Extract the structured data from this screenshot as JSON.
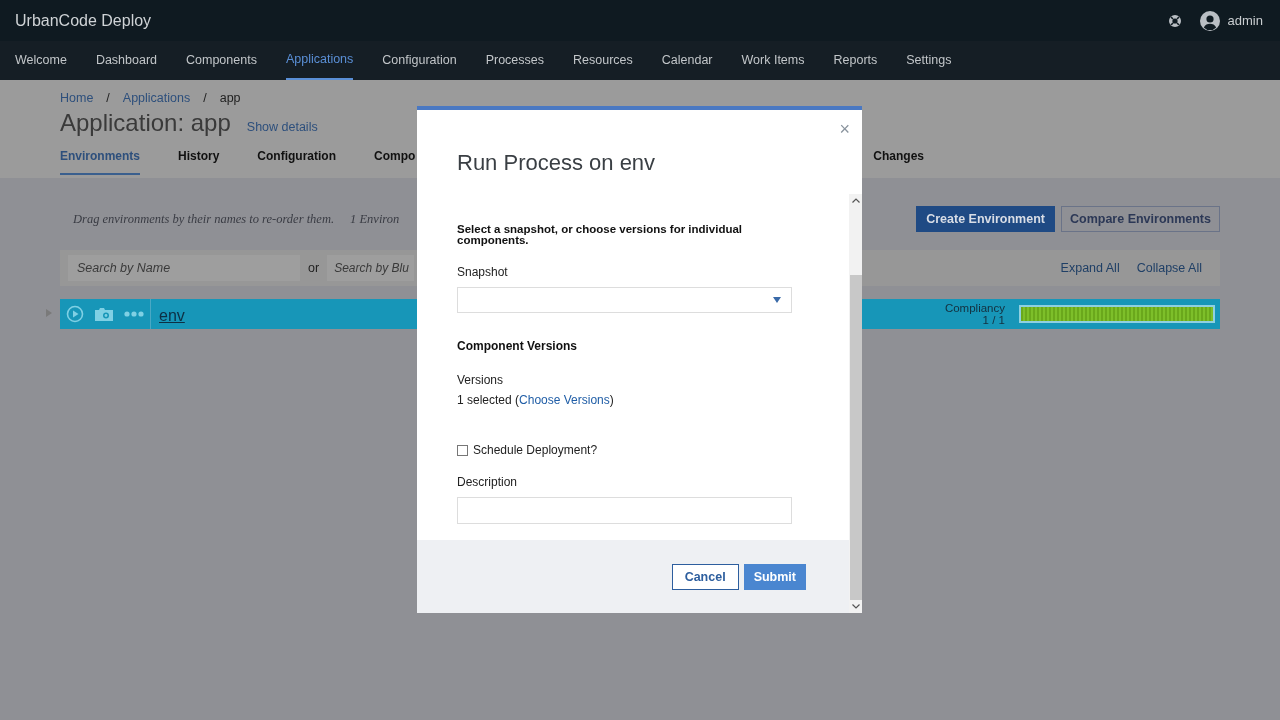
{
  "app_header": {
    "title": "UrbanCode Deploy",
    "user": "admin"
  },
  "nav": [
    {
      "label": "Welcome",
      "selected": false
    },
    {
      "label": "Dashboard",
      "selected": false
    },
    {
      "label": "Components",
      "selected": false
    },
    {
      "label": "Applications",
      "selected": true
    },
    {
      "label": "Configuration",
      "selected": false
    },
    {
      "label": "Processes",
      "selected": false
    },
    {
      "label": "Resources",
      "selected": false
    },
    {
      "label": "Calendar",
      "selected": false
    },
    {
      "label": "Work Items",
      "selected": false
    },
    {
      "label": "Reports",
      "selected": false
    },
    {
      "label": "Settings",
      "selected": false
    }
  ],
  "breadcrumb": [
    {
      "label": "Home",
      "kind": "link"
    },
    {
      "label": "/",
      "kind": "separator"
    },
    {
      "label": "Applications",
      "kind": "link"
    },
    {
      "label": "/",
      "kind": "separator"
    },
    {
      "label": "app",
      "kind": "current"
    }
  ],
  "page": {
    "title": "Application: app",
    "show_details": "Show details"
  },
  "tabs": [
    {
      "label": "Environments",
      "selected": true
    },
    {
      "label": "History",
      "selected": false
    },
    {
      "label": "Configuration",
      "selected": false
    },
    {
      "label": "Compo",
      "selected": false
    },
    {
      "label": "Changes",
      "selected": false
    }
  ],
  "environments": {
    "hint": "Drag environments by their names to re-order them.",
    "count": "1 Environ",
    "create_button": "Create Environment",
    "compare_button": {
      "label": "Compare Environments",
      "disabled": true
    },
    "search_name": {
      "placeholder": "Search by Name"
    },
    "or": "or",
    "search_blueprint": {
      "placeholder": "Search by Blu"
    },
    "expand_all": "Expand All",
    "collapse_all": "Collapse All",
    "rows": [
      {
        "name": "env",
        "expanded": false,
        "compliancy_label": "Compliancy",
        "compliancy_value": "1 / 1",
        "level": 1
      }
    ]
  },
  "modal": {
    "title": "Run Process on env",
    "close": "×",
    "instruction": "Select a snapshot, or choose versions for individual components.",
    "snapshot_label": "Snapshot",
    "section_title": "Component Versions",
    "versions_label": "Versions",
    "versions_prefix": "1 selected (",
    "versions_link": "Choose Versions",
    "versions_suffix": ")",
    "schedule": {
      "label": "Schedule Deployment?",
      "checked": false
    },
    "description_label": "Description",
    "cancel": "Cancel",
    "submit": "Submit"
  }
}
